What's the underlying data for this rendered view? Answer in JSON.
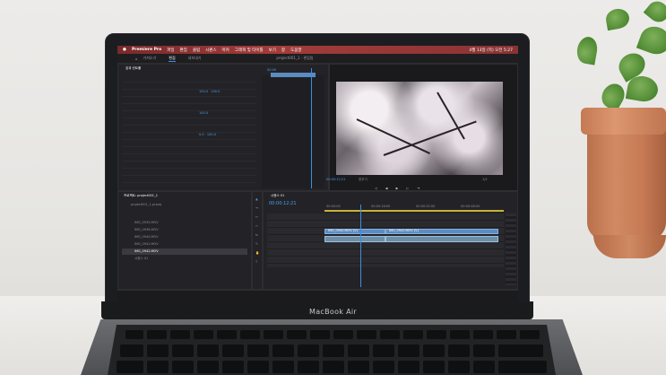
{
  "laptop_label": "MacBook Air",
  "screen": {
    "app_name": "Premiere Pro",
    "menu": [
      "파일",
      "편집",
      "클립",
      "시퀀스",
      "마커",
      "그래픽 및 타이틀",
      "보기",
      "창",
      "도움말"
    ],
    "clock": "4월 13일 (목) 오전 5:27",
    "tabs": [
      "가져오기",
      "편집",
      "내보내기"
    ],
    "project_title": "project001_1 - 편집됨",
    "timecode_program": "00:00:12:21",
    "timecode_timeline": "00:00:12:21",
    "project_panel_title": "프로젝트: project001_1",
    "project_file": "project001_1.prproj",
    "sequence_tab": "시퀀스 01",
    "clips": [
      "IMG_0935.MOV",
      "IMG_0936.MOV",
      "IMG_0940.MOV",
      "IMG_0941.MOV",
      "IMG_0942.MOV",
      "시퀀스 01"
    ],
    "clip_label_v1": "IMG_0942.MOV [V]",
    "clip_label_v2": "IMG_0942.MOV [V]",
    "ruler_times": [
      "00:00:00",
      "00:00:16:00",
      "00:00:32:00",
      "00:00:48:00"
    ],
    "effect_label": "효과 컨트롤",
    "fit_label": "맞추기",
    "quality": "1/2"
  }
}
